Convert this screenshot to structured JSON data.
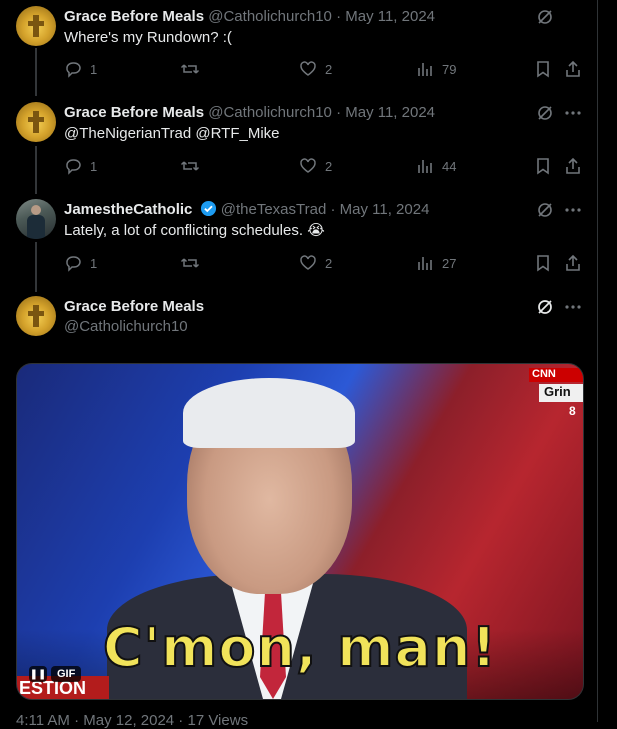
{
  "tweets": [
    {
      "name": "Grace Before Meals",
      "handle": "@Catholichurch10",
      "date": "May 11, 2024",
      "text": "Where's my Rundown? :(",
      "replies": "1",
      "likes": "2",
      "views": "79"
    },
    {
      "name": "Grace Before Meals",
      "handle": "@Catholichurch10",
      "date": "May 11, 2024",
      "text": "@TheNigerianTrad  @RTF_Mike",
      "replies": "1",
      "likes": "2",
      "views": "44"
    },
    {
      "name": "JamestheCatholic",
      "handle": "@theTexasTrad",
      "date": "May 11, 2024",
      "text": "Lately, a lot of conflicting schedules. 😭",
      "replies": "1",
      "likes": "2",
      "views": "27"
    }
  ],
  "main_tweet": {
    "name": "Grace Before Meals",
    "handle": "@Catholichurch10",
    "media": {
      "caption": "C'mon, man!",
      "gif_label": "GIF",
      "cnn_logo": "CNN",
      "cnn_box": "Grin",
      "cnn_num": "8",
      "lower_third": "ESTION"
    },
    "footer": "4:11 AM · May 12, 2024 · 17 Views"
  },
  "separator": "·",
  "colors": {
    "background": "#000000",
    "text": "#e7e9ea",
    "muted": "#71767b",
    "verified": "#1d9bf0"
  }
}
